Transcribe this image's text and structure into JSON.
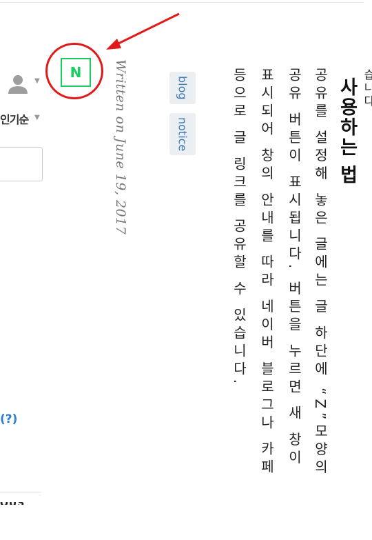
{
  "comments": {
    "sort_label": "인기순",
    "help_link": "(?)",
    "cut_heading": "OUS"
  },
  "share": {
    "naver_letter": "N"
  },
  "post": {
    "date": "Written on June 19, 2017",
    "tags": [
      "blog",
      "notice"
    ],
    "heading": "사용하는 법",
    "cut_text": "습니다",
    "lines": [
      "공유를 설정해 놓은 글에는 글 하단에 “Z”모양의",
      "공유 버튼이 표시됩니다. 버튼을 누르면 새 창이",
      "표시되어 창의 안내를 따라 네이버 블로그나 카페",
      "등으로 글 링크를 공유할 수 있습니다."
    ]
  },
  "colors": {
    "naver_green": "#19ce60",
    "annotation_red": "#e11919",
    "link_blue": "#2a7bd3"
  }
}
